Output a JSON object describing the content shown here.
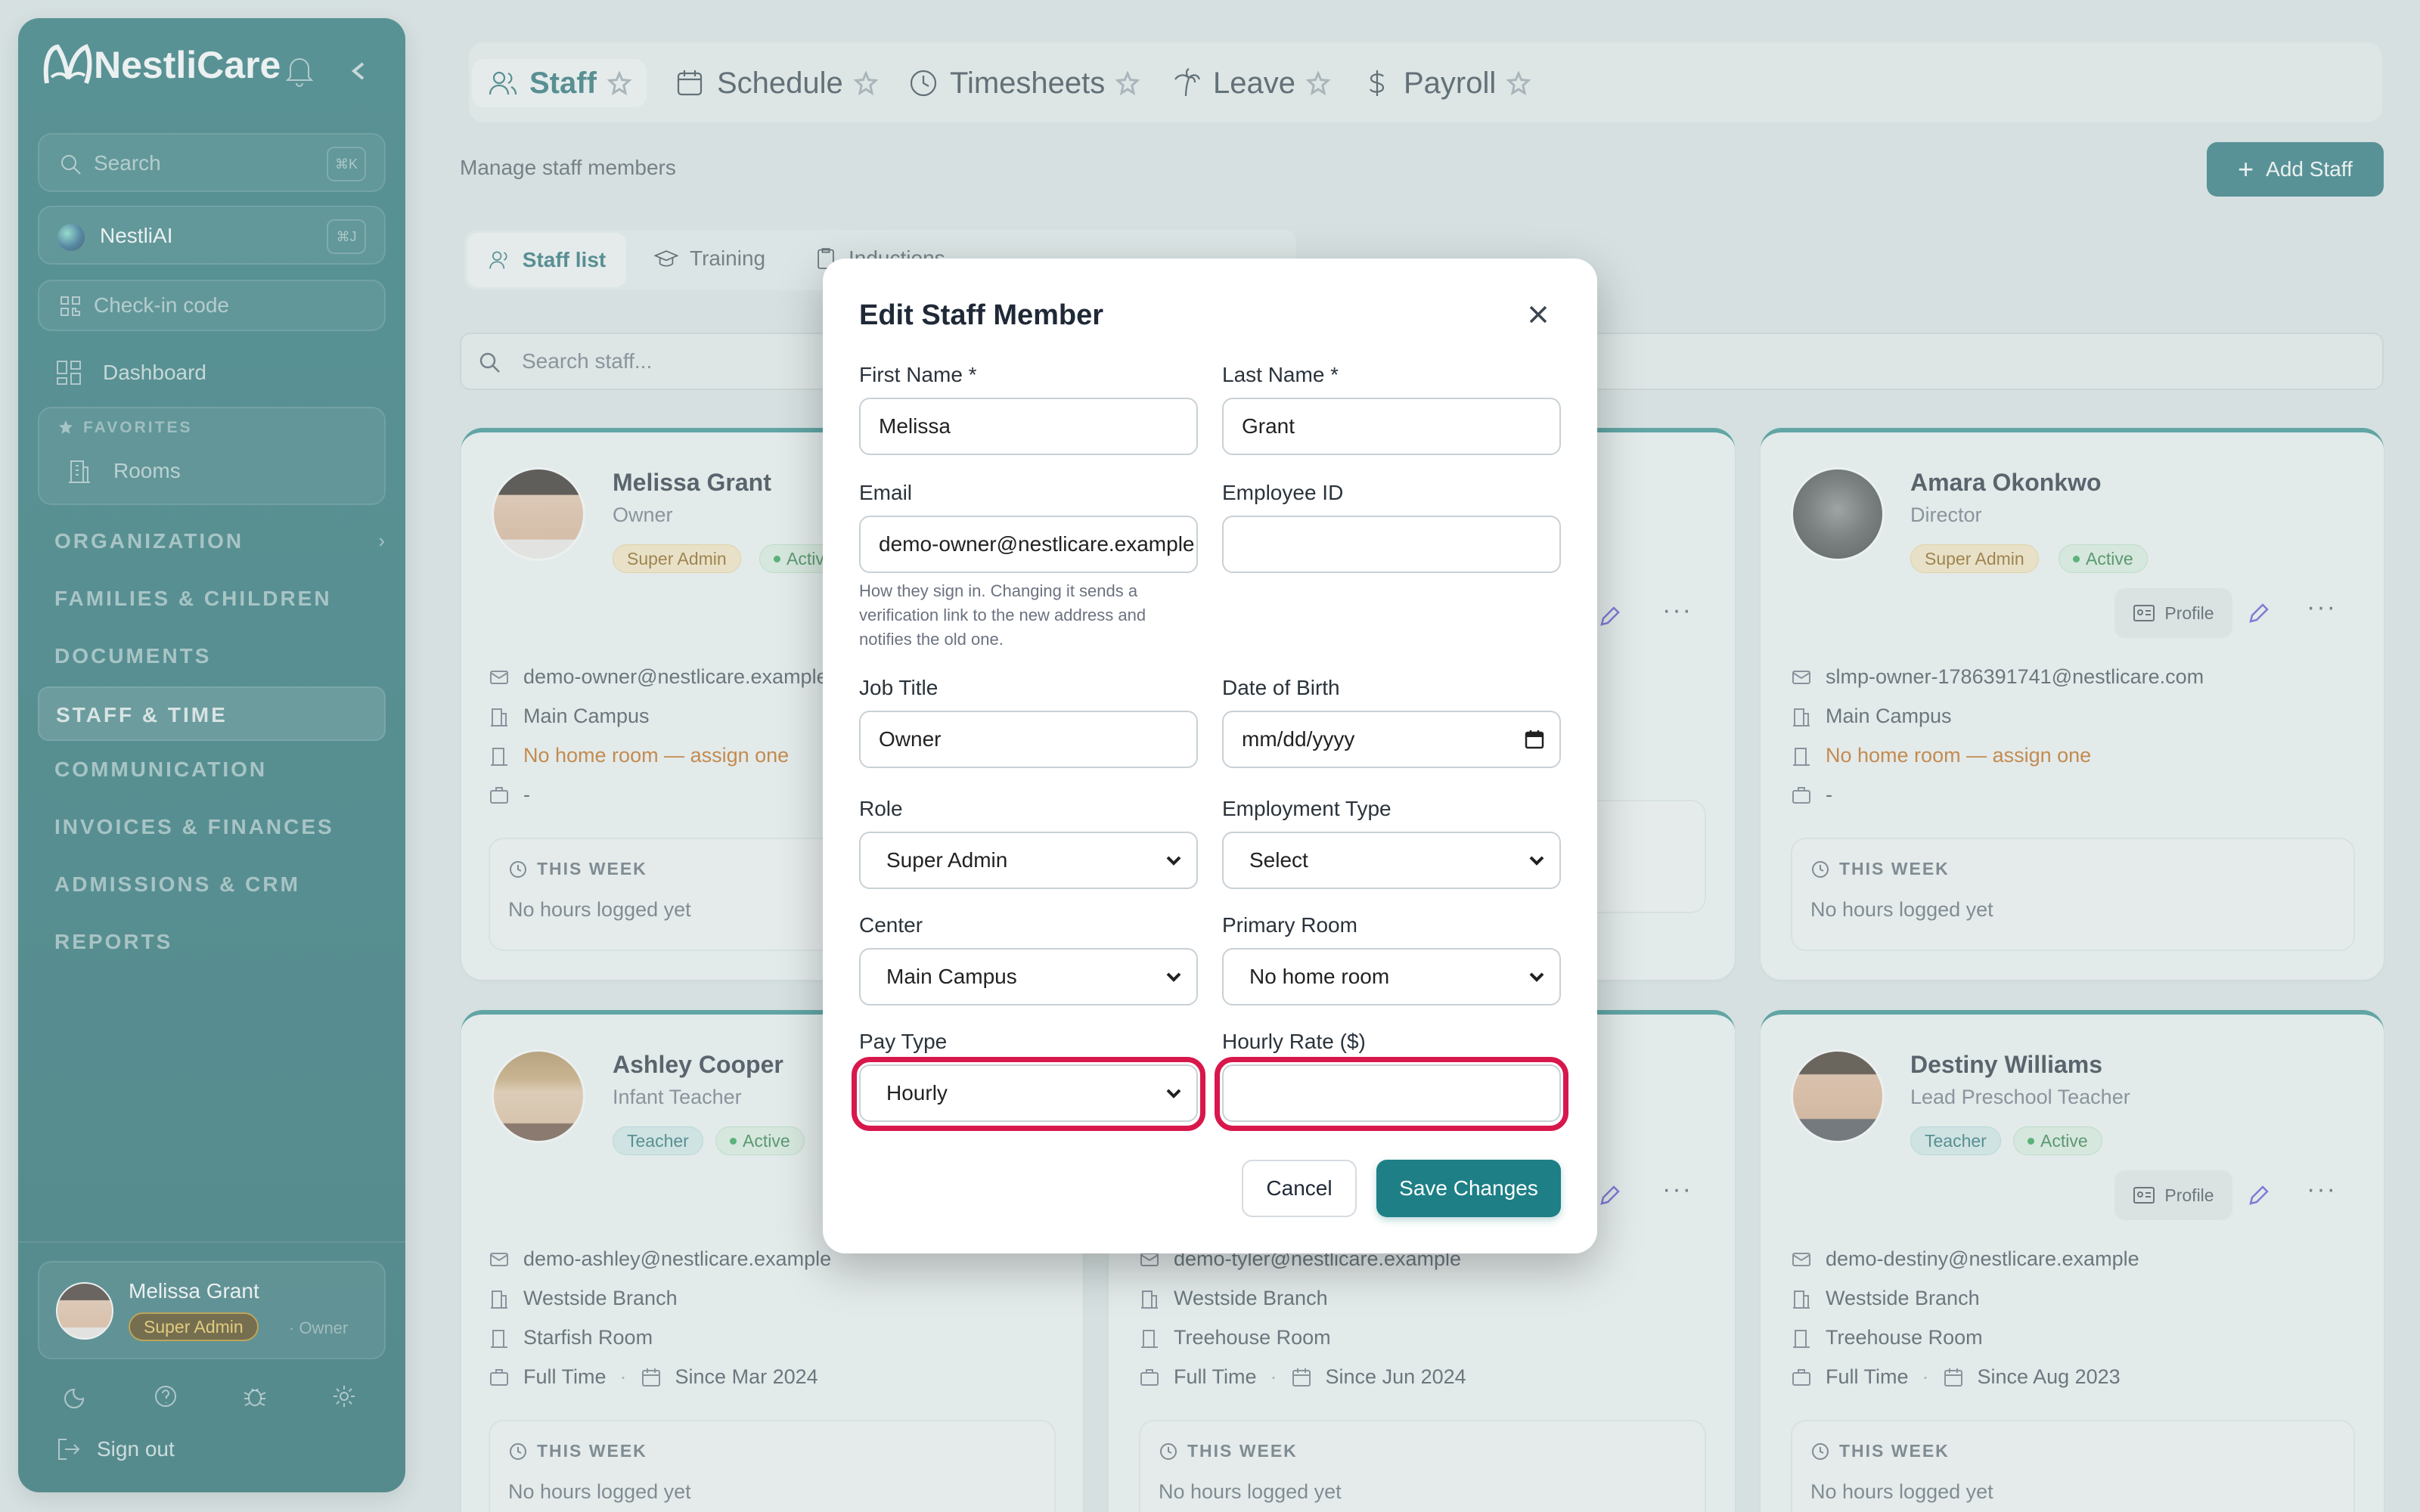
{
  "app": {
    "brand": "NestliCare",
    "brand_colors": {
      "sidebar": "#1f6f73",
      "accent": "#2b8c8c",
      "highlight": "#d8174c",
      "primary_button": "#1e7f86"
    }
  },
  "sidebar": {
    "search_placeholder": "Search",
    "search_shortcut": "⌘K",
    "ai_label": "NestliAI",
    "ai_shortcut": "⌘J",
    "checkin_label": "Check-in code",
    "dashboard_label": "Dashboard",
    "favorites_label": "FAVORITES",
    "favorites_items": [
      {
        "label": "Rooms"
      }
    ],
    "sections": [
      {
        "label": "ORGANIZATION"
      },
      {
        "label": "FAMILIES & CHILDREN"
      },
      {
        "label": "DOCUMENTS"
      },
      {
        "label": "STAFF & TIME"
      },
      {
        "label": "COMMUNICATION"
      },
      {
        "label": "INVOICES & FINANCES"
      },
      {
        "label": "ADMISSIONS & CRM"
      },
      {
        "label": "REPORTS"
      }
    ],
    "active_section": "STAFF & TIME",
    "user": {
      "name": "Melissa Grant",
      "badge": "Super Admin",
      "role": "· Owner"
    },
    "signout_label": "Sign out"
  },
  "topnav": {
    "tabs": [
      {
        "label": "Staff",
        "icon": "users-icon"
      },
      {
        "label": "Schedule",
        "icon": "calendar-icon"
      },
      {
        "label": "Timesheets",
        "icon": "clock-icon"
      },
      {
        "label": "Leave",
        "icon": "palm-tree-icon"
      },
      {
        "label": "Payroll",
        "icon": "dollar-icon"
      }
    ],
    "active": "Staff"
  },
  "page": {
    "subtitle": "Manage staff members",
    "add_button": "Add Staff",
    "subtabs": [
      {
        "label": "Staff list"
      },
      {
        "label": "Training"
      },
      {
        "label": "Inductions"
      }
    ],
    "search_placeholder": "Search staff..."
  },
  "cards": [
    {
      "name": "Melissa Grant",
      "role": "Owner",
      "badge": "Super Admin",
      "status": "Active",
      "email": "demo-owner@nestlicare.example",
      "center": "Main Campus",
      "room": "No home room — assign one",
      "employment": "-",
      "week_label": "THIS WEEK",
      "week_value": "No hours logged yet"
    },
    {
      "name": "Amara Okonkwo",
      "role": "Director",
      "badge": "Super Admin",
      "status": "Active",
      "email": "slmp-owner-1786391741@nestlicare.com",
      "center": "Main Campus",
      "room": "No home room — assign one",
      "employment": "-",
      "profile": "Profile",
      "week_label": "THIS WEEK",
      "week_value": "No hours logged yet"
    },
    {
      "name": "Ashley Cooper",
      "role": "Infant Teacher",
      "badge": "Teacher",
      "status": "Active",
      "email": "demo-ashley@nestlicare.example",
      "center": "Westside Branch",
      "room": "Starfish Room",
      "employment": "Full Time",
      "since": "Since Mar 2024",
      "week_label": "THIS WEEK",
      "week_value": "No hours logged yet"
    },
    {
      "email": "demo-tyler@nestlicare.example",
      "center": "Westside Branch",
      "room": "Treehouse Room",
      "employment": "Full Time",
      "since": "Since Jun 2024",
      "week_label": "THIS WEEK",
      "week_value": "No hours logged yet"
    },
    {
      "name": "Destiny Williams",
      "role": "Lead Preschool Teacher",
      "badge": "Teacher",
      "status": "Active",
      "email": "demo-destiny@nestlicare.example",
      "center": "Westside Branch",
      "room": "Treehouse Room",
      "employment": "Full Time",
      "since": "Since Aug 2023",
      "profile": "Profile",
      "week_label": "THIS WEEK",
      "week_value": "No hours logged yet"
    }
  ],
  "modal": {
    "title": "Edit Staff Member",
    "first_name_label": "First Name *",
    "first_name": "Melissa",
    "last_name_label": "Last Name *",
    "last_name": "Grant",
    "email_label": "Email",
    "email": "demo-owner@nestlicare.example",
    "email_help_1": "How they sign in. Changing it sends a",
    "email_help_2": "verification link to the new address and",
    "email_help_3": "notifies the old one.",
    "employee_id_label": "Employee ID",
    "employee_id": "",
    "job_title_label": "Job Title",
    "job_title": "Owner",
    "dob_label": "Date of Birth",
    "dob_placeholder": "mm/dd/yyyy",
    "role_label": "Role",
    "role": "Super Admin",
    "employment_type_label": "Employment Type",
    "employment_type": "Select",
    "center_label": "Center",
    "center": "Main Campus",
    "primary_room_label": "Primary Room",
    "primary_room": "No home room",
    "pay_type_label": "Pay Type",
    "pay_type": "Hourly",
    "hourly_rate_label": "Hourly Rate ($)",
    "hourly_rate": "",
    "cancel": "Cancel",
    "save": "Save Changes"
  }
}
